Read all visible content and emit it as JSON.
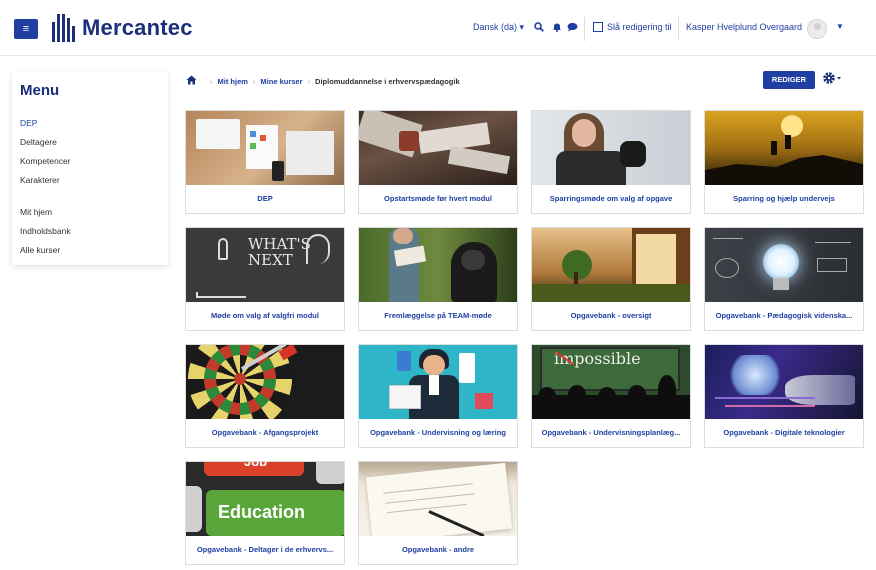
{
  "navbar": {
    "logo_text": "Mercantec",
    "language": "Dansk (da) ▾",
    "edit_toggle": "Slå redigering til",
    "user_name": "Kasper Hvelplund Overgaard"
  },
  "sidebar": {
    "title": "Menu",
    "items": [
      {
        "label": "DEP"
      },
      {
        "label": "Deltagere"
      },
      {
        "label": "Kompetencer"
      },
      {
        "label": "Karakterer"
      },
      {
        "label": "Mit hjem"
      },
      {
        "label": "Indholdsbank"
      },
      {
        "label": "Alle kurser"
      }
    ]
  },
  "breadcrumb": {
    "items": [
      "Mit hjem",
      "Mine kurser",
      "Diplomuddannelse i erhvervspædagogik"
    ]
  },
  "actions": {
    "edit_button": "REDIGER"
  },
  "cards": [
    {
      "label": "DEP"
    },
    {
      "label": "Opstartsmøde før hvert modul"
    },
    {
      "label": "Sparringsmøde om valg af opgave"
    },
    {
      "label": "Sparring og hjælp undervejs"
    },
    {
      "label": "Møde om valg af valgfri modul"
    },
    {
      "label": "Fremlæggelse på TEAM-møde"
    },
    {
      "label": "Opgavebank - oversigt"
    },
    {
      "label": "Opgavebank - Pædagogisk videnska..."
    },
    {
      "label": "Opgavebank - Afgangsprojekt"
    },
    {
      "label": "Opgavebank - Undervisning og læring"
    },
    {
      "label": "Opgavebank - Undervisningsplanlæg..."
    },
    {
      "label": "Opgavebank - Digitale teknologier"
    },
    {
      "label": "Opgavebank - Deltager i de erhvervs..."
    },
    {
      "label": "Opgavebank - andre"
    }
  ],
  "colors": {
    "brand": "#1b2f7a",
    "accent": "#1f3fa3"
  }
}
